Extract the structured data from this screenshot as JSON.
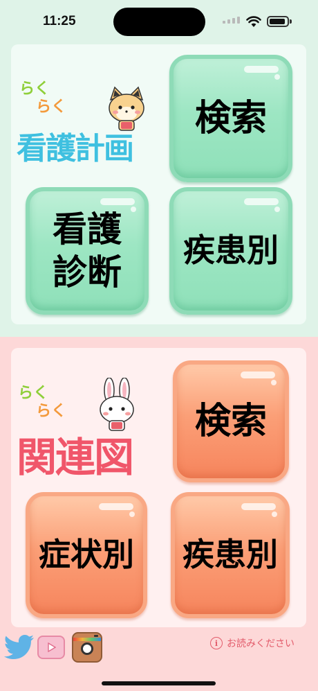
{
  "status_bar": {
    "time": "11:25"
  },
  "nursing_plan": {
    "logo_small": "らくらく",
    "logo_small_1": "らく",
    "logo_small_2": "らく",
    "logo_title": "看護計画",
    "buttons": {
      "search": "検索",
      "diagnosis_line1": "看護",
      "diagnosis_line2": "診断",
      "by_disease": "疾患別"
    },
    "colors": {
      "title": "#3fc0e0",
      "raku_1": "#8fcf3a",
      "raku_2": "#f39a3c",
      "button": "#9de6c3"
    }
  },
  "relation_chart": {
    "logo_small_1": "らく",
    "logo_small_2": "らく",
    "logo_title": "関連図",
    "buttons": {
      "search": "検索",
      "by_symptom": "症状別",
      "by_disease": "疾患別"
    },
    "colors": {
      "title": "#f0566a",
      "raku_1": "#8fcf3a",
      "raku_2": "#f39a3c",
      "button": "#fb9f77"
    }
  },
  "footer": {
    "icons": [
      "twitter-icon",
      "youtube-icon",
      "instagram-icon"
    ],
    "readme_label": "お読みください"
  }
}
